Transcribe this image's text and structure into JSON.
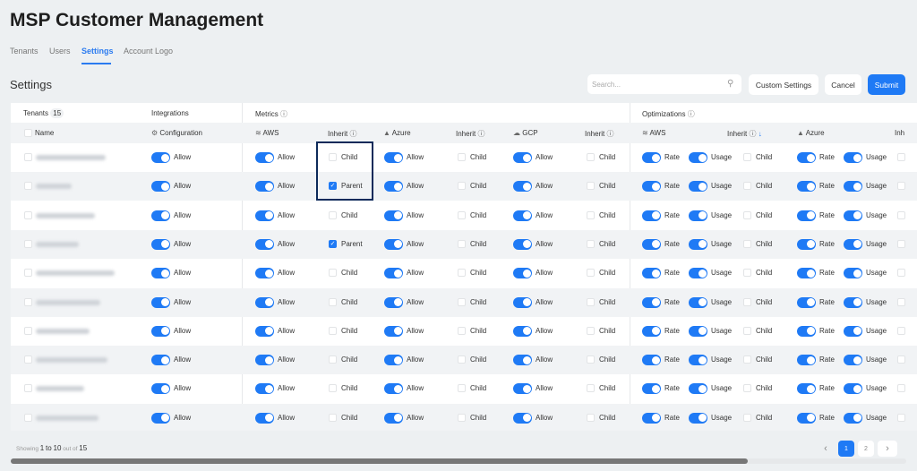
{
  "title": "MSP Customer Management",
  "tabs": [
    {
      "label": "Tenants"
    },
    {
      "label": "Users"
    },
    {
      "label": "Settings",
      "active": true
    },
    {
      "label": "Account Logo"
    }
  ],
  "section_title": "Settings",
  "search": {
    "placeholder": "Search..."
  },
  "buttons": {
    "custom": "Custom Settings",
    "cancel": "Cancel",
    "submit": "Submit"
  },
  "accent": "#1f7af5",
  "table": {
    "groups": {
      "tenants": "Tenants",
      "tenant_count": "15",
      "integrations": "Integrations",
      "metrics": "Metrics",
      "optimizations": "Optimizations"
    },
    "columns": {
      "name": "Name",
      "configuration": "Configuration",
      "aws": "AWS",
      "inherit": "Inherit",
      "azure": "Azure",
      "gcp": "GCP",
      "inherit_cut": "Inh"
    },
    "labels": {
      "allow": "Allow",
      "rate": "Rate",
      "usage": "Usage",
      "child": "Child",
      "parent": "Parent"
    },
    "rows": [
      {
        "metrics_aws_inherit": "Child"
      },
      {
        "metrics_aws_inherit": "Parent"
      },
      {
        "metrics_aws_inherit": "Child"
      },
      {
        "metrics_aws_inherit": "Parent"
      },
      {
        "metrics_aws_inherit": "Child"
      },
      {
        "metrics_aws_inherit": "Child"
      },
      {
        "metrics_aws_inherit": "Child"
      },
      {
        "metrics_aws_inherit": "Child"
      },
      {
        "metrics_aws_inherit": "Child"
      },
      {
        "metrics_aws_inherit": "Child"
      }
    ]
  },
  "footer": {
    "showing": "Showing",
    "from": "1",
    "to_word": "to",
    "to": "10",
    "out_of": "out of",
    "total": "15"
  },
  "pagination": {
    "pages": [
      "1",
      "2"
    ],
    "current": "1"
  }
}
